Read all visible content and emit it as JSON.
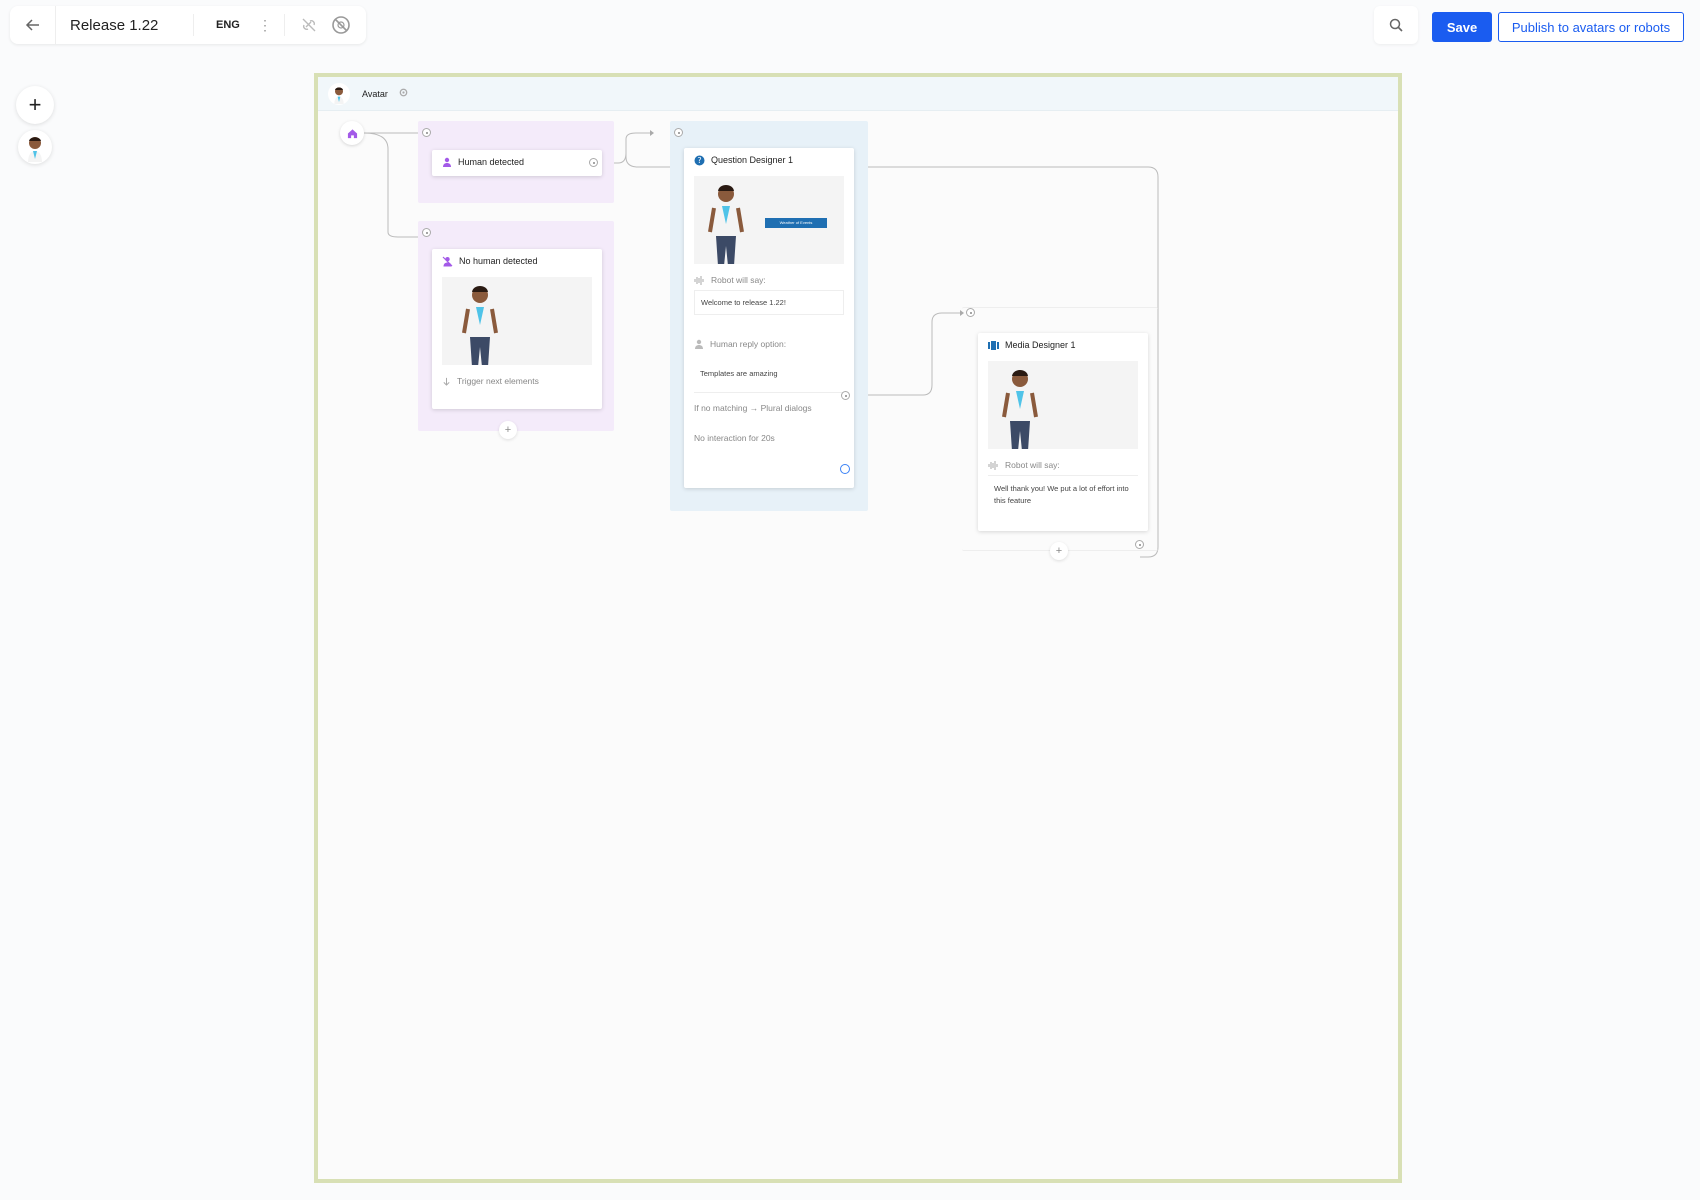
{
  "toolbar": {
    "title": "Release 1.22",
    "language": "ENG",
    "save_label": "Save",
    "publish_label": "Publish to avatars or robots"
  },
  "canvas": {
    "header_label": "Avatar"
  },
  "nodes": {
    "human_detected": {
      "title": "Human detected"
    },
    "no_human_detected": {
      "title": "No human detected",
      "trigger_label": "Trigger next elements"
    },
    "question_designer": {
      "title": "Question Designer 1",
      "media_button_text": "Weather of Events",
      "robot_say_label": "Robot will say:",
      "robot_say_text": "Welcome to release 1.22!",
      "reply_label": "Human reply option:",
      "reply_text": "Templates are amazing",
      "no_match_label": "If no matching → Plural dialogs",
      "no_interaction_label": "No interaction for 20s"
    },
    "media_designer": {
      "title": "Media Designer 1",
      "robot_say_label": "Robot will say:",
      "robot_say_text": "Well thank you! We put a lot of effort into this feature"
    }
  },
  "colors": {
    "accent": "#1a5cf0",
    "canvas_border": "#d8e0b5",
    "group_purple": "#f4ebfa",
    "group_blue": "#e7f1f8",
    "node_icon_purple": "#a35ae8",
    "node_icon_blue": "#1f6fb2"
  },
  "icons": [
    "back-arrow-icon",
    "more-vertical-icon",
    "link-off-icon",
    "block-icon",
    "search-icon",
    "plus-icon",
    "home-icon",
    "person-icon",
    "person-off-icon",
    "question-icon",
    "media-icon",
    "sound-wave-icon",
    "gear-icon",
    "arrow-down-icon"
  ]
}
